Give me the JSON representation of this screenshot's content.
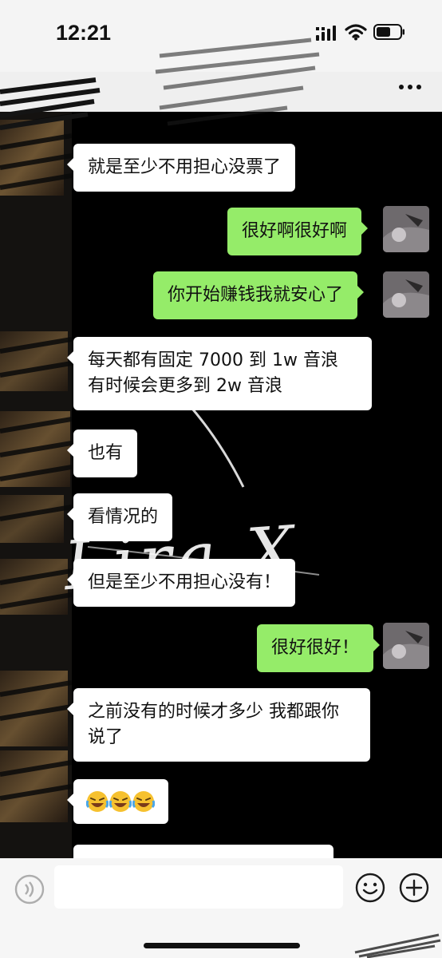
{
  "status_bar": {
    "time": "12:21"
  },
  "nav_bar": {
    "more_icon": "more-dots-icon"
  },
  "watermark": "Lira.X",
  "messages": [
    {
      "side": "in",
      "text": "就是至少不用担心没票了"
    },
    {
      "side": "out",
      "text": "很好啊很好啊"
    },
    {
      "side": "out",
      "text": "你开始赚钱我就安心了"
    },
    {
      "side": "in",
      "text": "每天都有固定 7000 到 1w 音浪 有时候会更多到 2w 音浪"
    },
    {
      "side": "in",
      "text": "也有"
    },
    {
      "side": "in",
      "text": "看情况的"
    },
    {
      "side": "in",
      "text": "但是至少不用担心没有！"
    },
    {
      "side": "out",
      "text": "很好很好！"
    },
    {
      "side": "in",
      "text": "之前没有的时候才多少 我都跟你说了"
    },
    {
      "side": "in",
      "emoji": [
        "rolling-laughing-face",
        "rolling-laughing-face",
        "rolling-laughing-face"
      ]
    }
  ],
  "input_bar": {
    "value": "",
    "icons": [
      "voice-icon",
      "emoji-icon",
      "plus-icon"
    ]
  },
  "colors": {
    "outgoing_bubble": "#95ec69",
    "incoming_bubble": "#ffffff",
    "chat_background": "#000000"
  }
}
